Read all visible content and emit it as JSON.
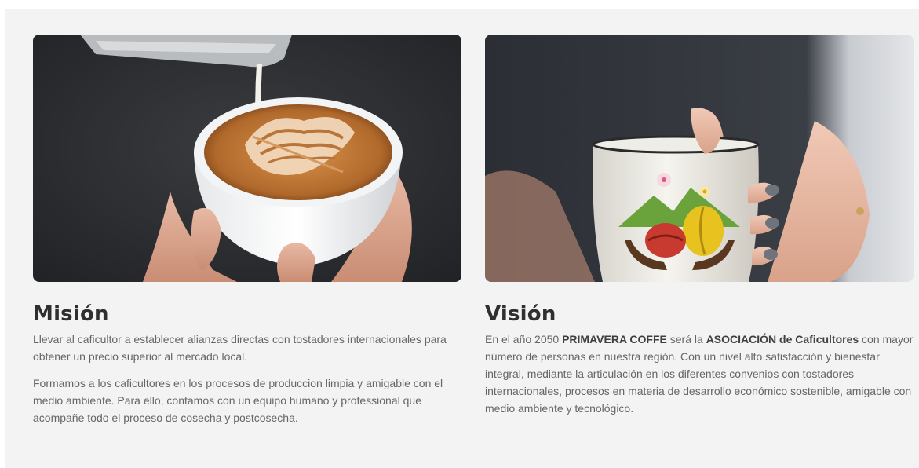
{
  "mision": {
    "title": "Misión",
    "paragraph_1": "Llevar al caficultor a establecer alianzas directas con tostadores internacionales para obtener un precio superior al mercado local.",
    "paragraph_2": "Formamos a los caficultores en los procesos de produccion limpia y amigable con el medio ambiente. Para ello, contamos con un equipo humano y professional que acompañe todo el proceso de cosecha y postcosecha."
  },
  "vision": {
    "title": "Visión",
    "text_1": "En el año 2050 ",
    "brand": "PRIMAVERA COFFE",
    "text_2": " será la ",
    "association": "ASOCIACIÓN de Caficultores",
    "text_3": " con mayor número de personas en nuestra región. Con un nivel alto satisfacción y bienestar integral, mediante la articulación en los diferentes convenios con tostadores internacionales, procesos en materia de desarrollo económico sostenible, amigable con medio ambiente y tecnológico."
  }
}
